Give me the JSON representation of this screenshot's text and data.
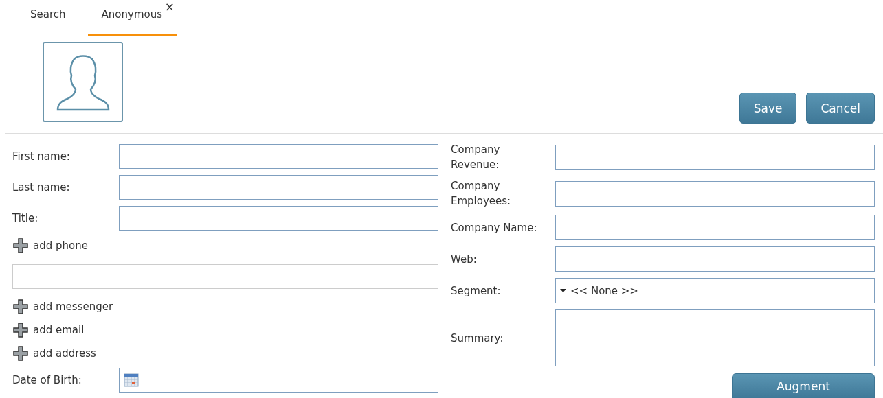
{
  "tabs": [
    {
      "label": "Search",
      "selected": false
    },
    {
      "label": "Anonymous",
      "selected": true,
      "close": "×"
    }
  ],
  "actions": [
    "Save",
    "Cancel"
  ],
  "left": [
    {
      "kind": "field",
      "label": "First name:"
    },
    {
      "kind": "field",
      "label": "Last name:"
    },
    {
      "kind": "field",
      "label": "Title:"
    },
    {
      "kind": "add",
      "label": "add phone"
    },
    {
      "kind": "plain"
    },
    {
      "kind": "add",
      "label": "add messenger"
    },
    {
      "kind": "add",
      "label": "add email"
    },
    {
      "kind": "add",
      "label": "add address"
    },
    {
      "kind": "date",
      "label": "Date of Birth:"
    }
  ],
  "right": [
    {
      "kind": "text",
      "label": "Company Revenue:"
    },
    {
      "kind": "text",
      "label": "Company Employees:"
    },
    {
      "kind": "text",
      "label": "Company Name:"
    },
    {
      "kind": "text",
      "label": "Web:"
    },
    {
      "kind": "select",
      "label": "Segment:",
      "value": "<< None >>"
    },
    {
      "kind": "textarea",
      "label": "Summary:"
    }
  ],
  "augment": "Augment"
}
